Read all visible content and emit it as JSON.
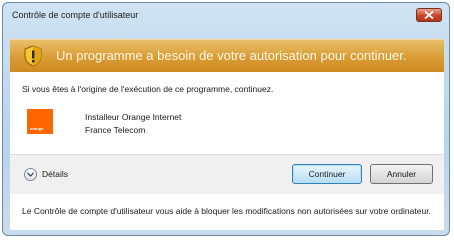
{
  "window": {
    "title": "Contrôle de compte d'utilisateur"
  },
  "banner": {
    "text": "Un programme a besoin de votre autorisation pour continuer."
  },
  "content": {
    "intro": "Si vous êtes à l'origine de l'exécution de ce programme, continuez.",
    "program_name": "Installeur Orange Internet",
    "publisher": "France Telecom",
    "logo_text": "orange"
  },
  "actions": {
    "details_label": "Détails",
    "continue_label": "Continuer",
    "cancel_label": "Annuler"
  },
  "footer": {
    "text": "Le Contrôle de compte d'utilisateur vous aide à bloquer les modifications non autorisées sur votre ordinateur."
  },
  "colors": {
    "banner": "#d99c35",
    "logo": "#ff6600",
    "close_button": "#c9452b"
  }
}
